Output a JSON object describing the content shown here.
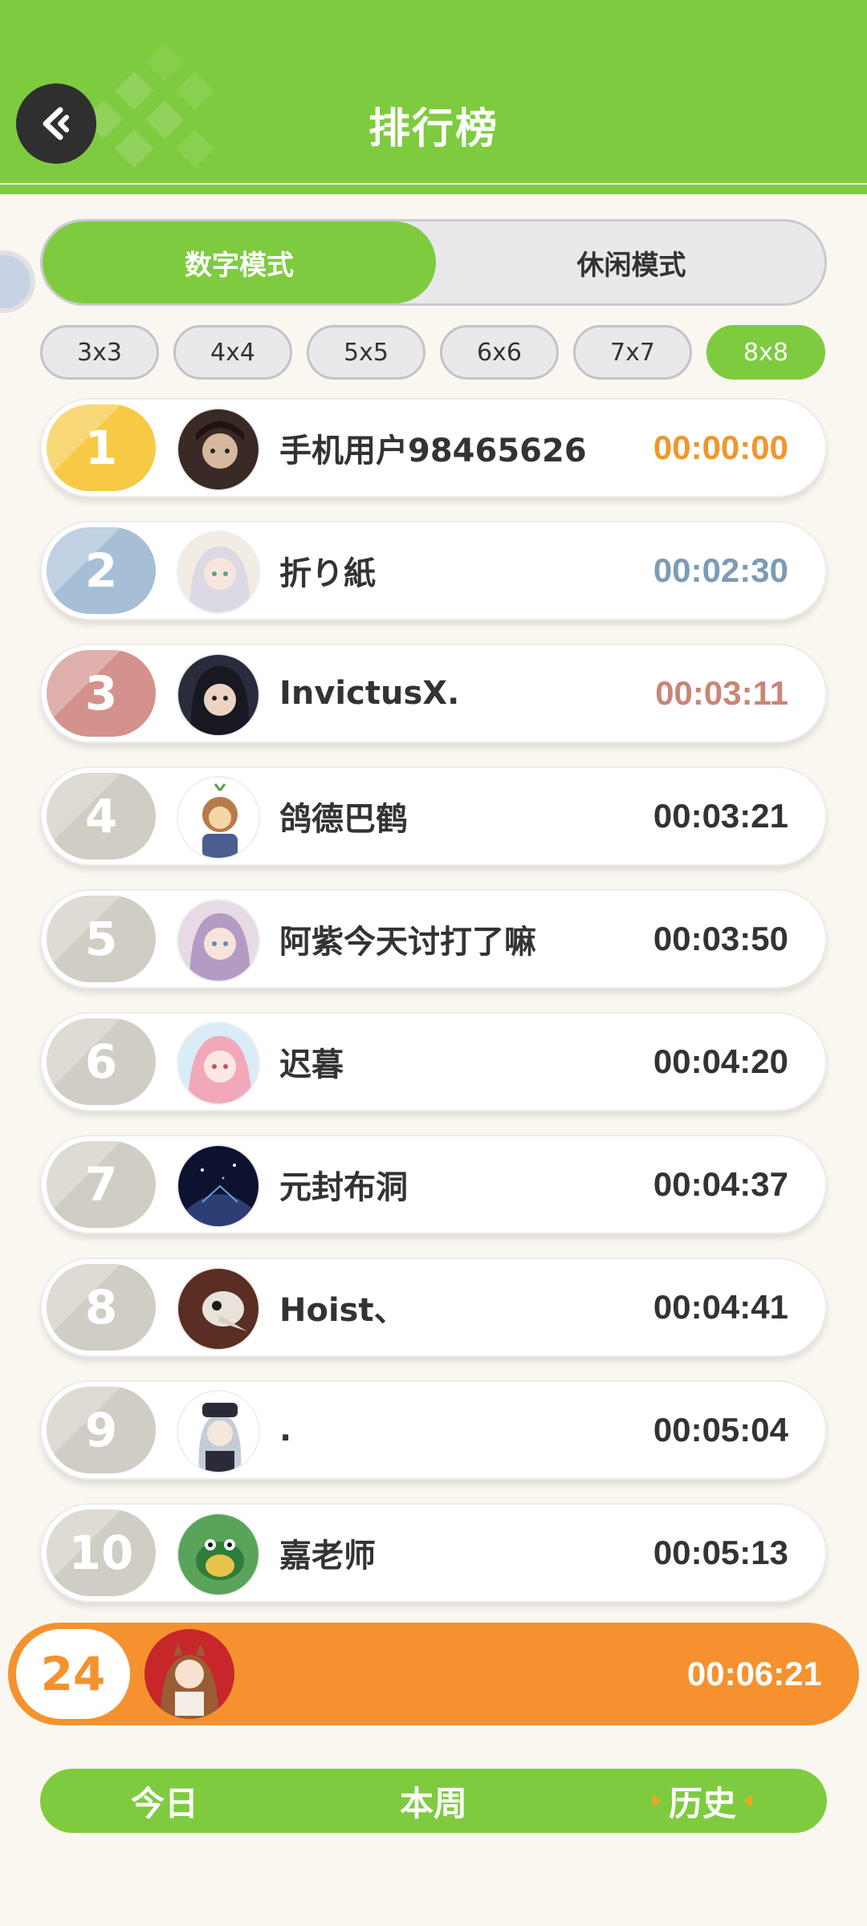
{
  "header": {
    "title": "排行榜",
    "back_icon": "back-arrow-icon"
  },
  "modes": {
    "active": "数字模式",
    "inactive": "休闲模式"
  },
  "sizes": [
    "3x3",
    "4x4",
    "5x5",
    "6x6",
    "7x7",
    "8x8"
  ],
  "selected_size": "8x8",
  "colors": {
    "green": "#7ecb40",
    "orange": "#f5922f",
    "gold": "#f7c945",
    "silver": "#a6bfd7",
    "bronze": "#d3928c",
    "gray_rank": "#d0cdc4",
    "time_gold": "#f0962c",
    "time_silver": "#7d9bb6",
    "time_bronze": "#c98578"
  },
  "rankings": [
    {
      "rank": "1",
      "name": "手机用户98465626",
      "time": "00:00:00"
    },
    {
      "rank": "2",
      "name": "折り紙",
      "time": "00:02:30"
    },
    {
      "rank": "3",
      "name": "InvictusX.",
      "time": "00:03:11"
    },
    {
      "rank": "4",
      "name": "鸽德巴鹤",
      "time": "00:03:21"
    },
    {
      "rank": "5",
      "name": "阿紫今天讨打了嘛",
      "time": "00:03:50"
    },
    {
      "rank": "6",
      "name": "迟暮",
      "time": "00:04:20"
    },
    {
      "rank": "7",
      "name": "元封布洞",
      "time": "00:04:37"
    },
    {
      "rank": "8",
      "name": "Hoist、",
      "time": "00:04:41"
    },
    {
      "rank": "9",
      "name": ".",
      "time": "00:05:04"
    },
    {
      "rank": "10",
      "name": "嘉老师",
      "time": "00:05:13"
    }
  ],
  "my_entry": {
    "rank": "24",
    "time": "00:06:21"
  },
  "periods": [
    "今日",
    "本周",
    "历史"
  ],
  "selected_period": "历史"
}
